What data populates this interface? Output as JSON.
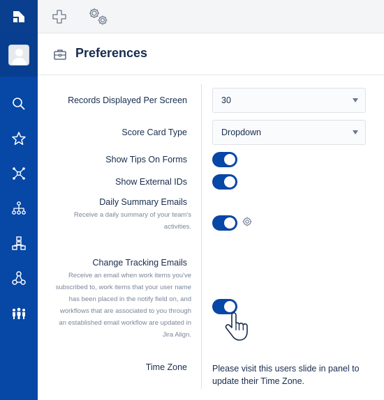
{
  "topbar": {
    "add_icon": "plus-icon",
    "settings_icon": "gears-icon"
  },
  "sidebar": {
    "logo_icon": "jira-align-logo-icon",
    "items": [
      {
        "icon": "search-icon"
      },
      {
        "icon": "star-icon"
      },
      {
        "icon": "network-icon"
      },
      {
        "icon": "hierarchy-icon"
      },
      {
        "icon": "org-chart-icon"
      },
      {
        "icon": "team-nodes-icon"
      },
      {
        "icon": "people-icon"
      }
    ]
  },
  "header": {
    "title": "Preferences",
    "icon": "briefcase-icon"
  },
  "form": {
    "records_label": "Records Displayed Per Screen",
    "records_value": "30",
    "scorecard_label": "Score Card Type",
    "scorecard_value": "Dropdown",
    "tips_label": "Show Tips On Forms",
    "tips_on": true,
    "external_ids_label": "Show External IDs",
    "external_ids_on": true,
    "daily_label": "Daily Summary Emails",
    "daily_desc": "Receive a daily summary of your team's activities.",
    "daily_on": true,
    "change_label": "Change Tracking Emails",
    "change_desc": "Receive an email when work items you've subscribed to, work items that your user name has been placed in the notify field on, and workflows that are associated to you through an established email workflow are updated in Jira Align.",
    "change_on": true,
    "timezone_label": "Time Zone",
    "timezone_text": "Please visit this users slide in panel to update their Time Zone."
  },
  "colors": {
    "sidebar": "#0747a6",
    "toggle_on": "#0747a6",
    "text": "#172b4d",
    "muted": "#7a869a"
  }
}
